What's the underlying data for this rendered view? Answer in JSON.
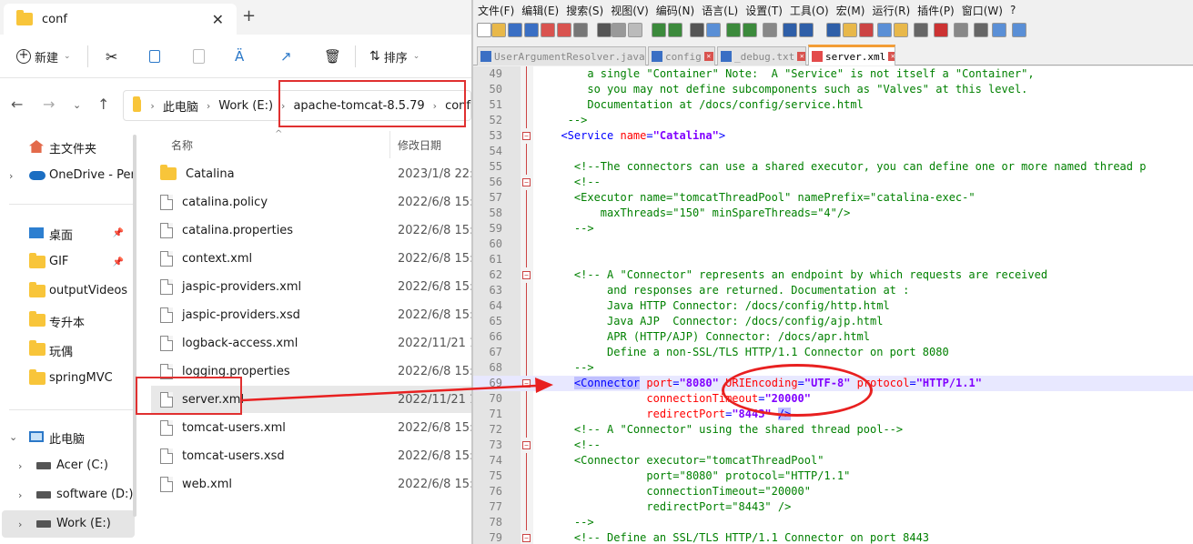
{
  "explorer": {
    "tab_title": "conf",
    "tab_close": "✕",
    "new_tab": "+",
    "toolbar": {
      "new_label": "新建",
      "sort_label": "排序"
    },
    "address": [
      "此电脑",
      "Work (E:)",
      "apache-tomcat-8.5.79",
      "conf"
    ],
    "sidebar": [
      {
        "label": "主文件夹",
        "icon": "home-icon"
      },
      {
        "label": "OneDrive - Per",
        "icon": "onedrive-icon",
        "expand": "›"
      },
      {
        "label": "桌面",
        "icon": "desktop-icon",
        "pinned": true
      },
      {
        "label": "GIF",
        "icon": "folder-icon",
        "pinned": true
      },
      {
        "label": "outputVideos",
        "icon": "folder-icon"
      },
      {
        "label": "专升本",
        "icon": "folder-icon"
      },
      {
        "label": "玩偶",
        "icon": "folder-icon"
      },
      {
        "label": "springMVC",
        "icon": "folder-icon"
      },
      {
        "label": "此电脑",
        "icon": "this-pc-icon",
        "expand": "⌄"
      },
      {
        "label": "Acer (C:)",
        "icon": "drive-icon",
        "expand": "›"
      },
      {
        "label": "software (D:)",
        "icon": "drive-icon",
        "expand": "›"
      },
      {
        "label": "Work (E:)",
        "icon": "drive-icon",
        "expand": "›"
      }
    ],
    "columns": {
      "name": "名称",
      "modified": "修改日期"
    },
    "files": [
      {
        "name": "Catalina",
        "date": "2023/1/8 22:5",
        "type": "folder"
      },
      {
        "name": "catalina.policy",
        "date": "2022/6/8 15:0",
        "type": "file"
      },
      {
        "name": "catalina.properties",
        "date": "2022/6/8 15:0",
        "type": "file"
      },
      {
        "name": "context.xml",
        "date": "2022/6/8 15:0",
        "type": "file"
      },
      {
        "name": "jaspic-providers.xml",
        "date": "2022/6/8 15:0",
        "type": "file"
      },
      {
        "name": "jaspic-providers.xsd",
        "date": "2022/6/8 15:0",
        "type": "file"
      },
      {
        "name": "logback-access.xml",
        "date": "2022/11/21 1:",
        "type": "file"
      },
      {
        "name": "logging.properties",
        "date": "2022/6/8 15:1",
        "type": "file"
      },
      {
        "name": "server.xml",
        "date": "2022/11/21 1:",
        "type": "file",
        "selected": true
      },
      {
        "name": "tomcat-users.xml",
        "date": "2022/6/8 15:0",
        "type": "file"
      },
      {
        "name": "tomcat-users.xsd",
        "date": "2022/6/8 15:0",
        "type": "file"
      },
      {
        "name": "web.xml",
        "date": "2022/6/8 15:0",
        "type": "file"
      }
    ]
  },
  "npp": {
    "menu": [
      "文件(F)",
      "编辑(E)",
      "搜索(S)",
      "视图(V)",
      "编码(N)",
      "语言(L)",
      "设置(T)",
      "工具(O)",
      "宏(M)",
      "运行(R)",
      "插件(P)",
      "窗口(W)",
      "?"
    ],
    "tabs": [
      "UserArgumentResolver.java",
      "config",
      "_debug.txt",
      "server.xml"
    ],
    "tab_close": "✕",
    "fold_open": "−",
    "lines": [
      {
        "n": "49",
        "parts": [
          {
            "c": "cm",
            "t": "      a single \"Container\" Note:  A \"Service\" is not itself a \"Container\","
          }
        ]
      },
      {
        "n": "50",
        "parts": [
          {
            "c": "cm",
            "t": "      so you may not define subcomponents such as \"Valves\" at this level."
          }
        ]
      },
      {
        "n": "51",
        "parts": [
          {
            "c": "cm",
            "t": "      Documentation at /docs/config/service.html"
          }
        ]
      },
      {
        "n": "52",
        "parts": [
          {
            "c": "cm",
            "t": "   -->"
          }
        ]
      },
      {
        "n": "53",
        "fold": true,
        "parts": [
          {
            "c": "tg",
            "t": "  <Service "
          },
          {
            "c": "at",
            "t": "name"
          },
          {
            "c": "tg",
            "t": "="
          },
          {
            "c": "av",
            "t": "\"Catalina\""
          },
          {
            "c": "tg",
            "t": ">"
          }
        ]
      },
      {
        "n": "54",
        "parts": [
          {
            "c": "",
            "t": ""
          }
        ]
      },
      {
        "n": "55",
        "parts": [
          {
            "c": "cm",
            "t": "    <!--The connectors can use a shared executor, you can define one or more named thread p"
          }
        ]
      },
      {
        "n": "56",
        "fold": true,
        "parts": [
          {
            "c": "cm",
            "t": "    <!--"
          }
        ]
      },
      {
        "n": "57",
        "parts": [
          {
            "c": "cm",
            "t": "    <Executor name=\"tomcatThreadPool\" namePrefix=\"catalina-exec-\""
          }
        ]
      },
      {
        "n": "58",
        "parts": [
          {
            "c": "cm",
            "t": "        maxThreads=\"150\" minSpareThreads=\"4\"/>"
          }
        ]
      },
      {
        "n": "59",
        "parts": [
          {
            "c": "cm",
            "t": "    -->"
          }
        ]
      },
      {
        "n": "60",
        "parts": [
          {
            "c": "",
            "t": ""
          }
        ]
      },
      {
        "n": "61",
        "parts": [
          {
            "c": "",
            "t": ""
          }
        ]
      },
      {
        "n": "62",
        "fold": true,
        "parts": [
          {
            "c": "cm",
            "t": "    <!-- A \"Connector\" represents an endpoint by which requests are received"
          }
        ]
      },
      {
        "n": "63",
        "parts": [
          {
            "c": "cm",
            "t": "         and responses are returned. Documentation at :"
          }
        ]
      },
      {
        "n": "64",
        "parts": [
          {
            "c": "cm",
            "t": "         Java HTTP Connector: /docs/config/http.html"
          }
        ]
      },
      {
        "n": "65",
        "parts": [
          {
            "c": "cm",
            "t": "         Java AJP  Connector: /docs/config/ajp.html"
          }
        ]
      },
      {
        "n": "66",
        "parts": [
          {
            "c": "cm",
            "t": "         APR (HTTP/AJP) Connector: /docs/apr.html"
          }
        ]
      },
      {
        "n": "67",
        "parts": [
          {
            "c": "cm",
            "t": "         Define a non-SSL/TLS HTTP/1.1 Connector on port 8080"
          }
        ]
      },
      {
        "n": "68",
        "parts": [
          {
            "c": "cm",
            "t": "    -->"
          }
        ]
      },
      {
        "n": "69",
        "fold": true,
        "cur": true,
        "parts": [
          {
            "c": "",
            "t": "    "
          },
          {
            "c": "tg hl",
            "t": "<Connector"
          },
          {
            "c": "",
            "t": " "
          },
          {
            "c": "at",
            "t": "port"
          },
          {
            "c": "tg",
            "t": "="
          },
          {
            "c": "av",
            "t": "\"8080\""
          },
          {
            "c": "",
            "t": " "
          },
          {
            "c": "at",
            "t": "URIEncoding"
          },
          {
            "c": "tg",
            "t": "="
          },
          {
            "c": "av",
            "t": "\"UTF-8\""
          },
          {
            "c": "",
            "t": " "
          },
          {
            "c": "at",
            "t": "protocol"
          },
          {
            "c": "tg",
            "t": "="
          },
          {
            "c": "av",
            "t": "\"HTTP/1.1\""
          }
        ]
      },
      {
        "n": "70",
        "parts": [
          {
            "c": "",
            "t": "               "
          },
          {
            "c": "at",
            "t": "connectionTimeout"
          },
          {
            "c": "tg",
            "t": "="
          },
          {
            "c": "av",
            "t": "\"20000\""
          }
        ]
      },
      {
        "n": "71",
        "parts": [
          {
            "c": "",
            "t": "               "
          },
          {
            "c": "at",
            "t": "redirectPort"
          },
          {
            "c": "tg",
            "t": "="
          },
          {
            "c": "av",
            "t": "\"8443\""
          },
          {
            "c": "",
            "t": " "
          },
          {
            "c": "tg hl",
            "t": "/>"
          }
        ]
      },
      {
        "n": "72",
        "parts": [
          {
            "c": "cm",
            "t": "    <!-- A \"Connector\" using the shared thread pool-->"
          }
        ]
      },
      {
        "n": "73",
        "fold": true,
        "parts": [
          {
            "c": "cm",
            "t": "    <!--"
          }
        ]
      },
      {
        "n": "74",
        "parts": [
          {
            "c": "cm",
            "t": "    <Connector executor=\"tomcatThreadPool\""
          }
        ]
      },
      {
        "n": "75",
        "parts": [
          {
            "c": "cm",
            "t": "               port=\"8080\" protocol=\"HTTP/1.1\""
          }
        ]
      },
      {
        "n": "76",
        "parts": [
          {
            "c": "cm",
            "t": "               connectionTimeout=\"20000\""
          }
        ]
      },
      {
        "n": "77",
        "parts": [
          {
            "c": "cm",
            "t": "               redirectPort=\"8443\" />"
          }
        ]
      },
      {
        "n": "78",
        "parts": [
          {
            "c": "cm",
            "t": "    -->"
          }
        ]
      },
      {
        "n": "79",
        "fold": true,
        "parts": [
          {
            "c": "cm",
            "t": "    <!-- Define an SSL/TLS HTTP/1.1 Connector on port 8443"
          }
        ]
      }
    ]
  },
  "colors": {
    "annotation_red": "#e03030",
    "comment_green": "#008000",
    "tag_blue": "#0000ff",
    "attr_red": "#ff0000",
    "value_purple": "#8000ff"
  }
}
